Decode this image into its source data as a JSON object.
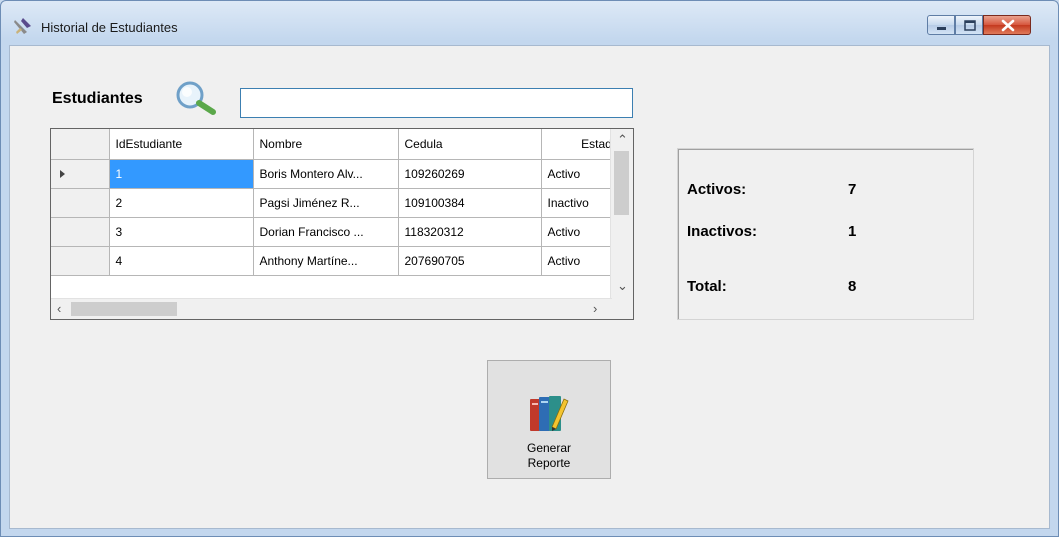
{
  "window": {
    "title": "Historial de Estudiantes",
    "icon": "app-brush-icon"
  },
  "search": {
    "label": "Estudiantes",
    "value": "",
    "icon": "search-icon"
  },
  "grid": {
    "columns": [
      "IdEstudiante",
      "Nombre",
      "Cedula",
      "Estado"
    ],
    "rows": [
      {
        "id": "1",
        "nombre": "Boris Montero Alv...",
        "cedula": "109260269",
        "estado": "Activo"
      },
      {
        "id": "2",
        "nombre": "Pagsi Jiménez R...",
        "cedula": "109100384",
        "estado": "Inactivo"
      },
      {
        "id": "3",
        "nombre": "Dorian Francisco ...",
        "cedula": "118320312",
        "estado": "Activo"
      },
      {
        "id": "4",
        "nombre": "Anthony Martíne...",
        "cedula": "207690705",
        "estado": "Activo"
      }
    ],
    "selected_row": 0
  },
  "stats": {
    "activos_label": "Activos:",
    "activos_value": "7",
    "inactivos_label": "Inactivos:",
    "inactivos_value": "1",
    "total_label": "Total:",
    "total_value": "8"
  },
  "report_button": {
    "label": "Generar\nReporte",
    "icon": "books-icon"
  },
  "colors": {
    "selection": "#3399ff",
    "input_border": "#3c7fb1",
    "close_button": "#c4391f"
  }
}
